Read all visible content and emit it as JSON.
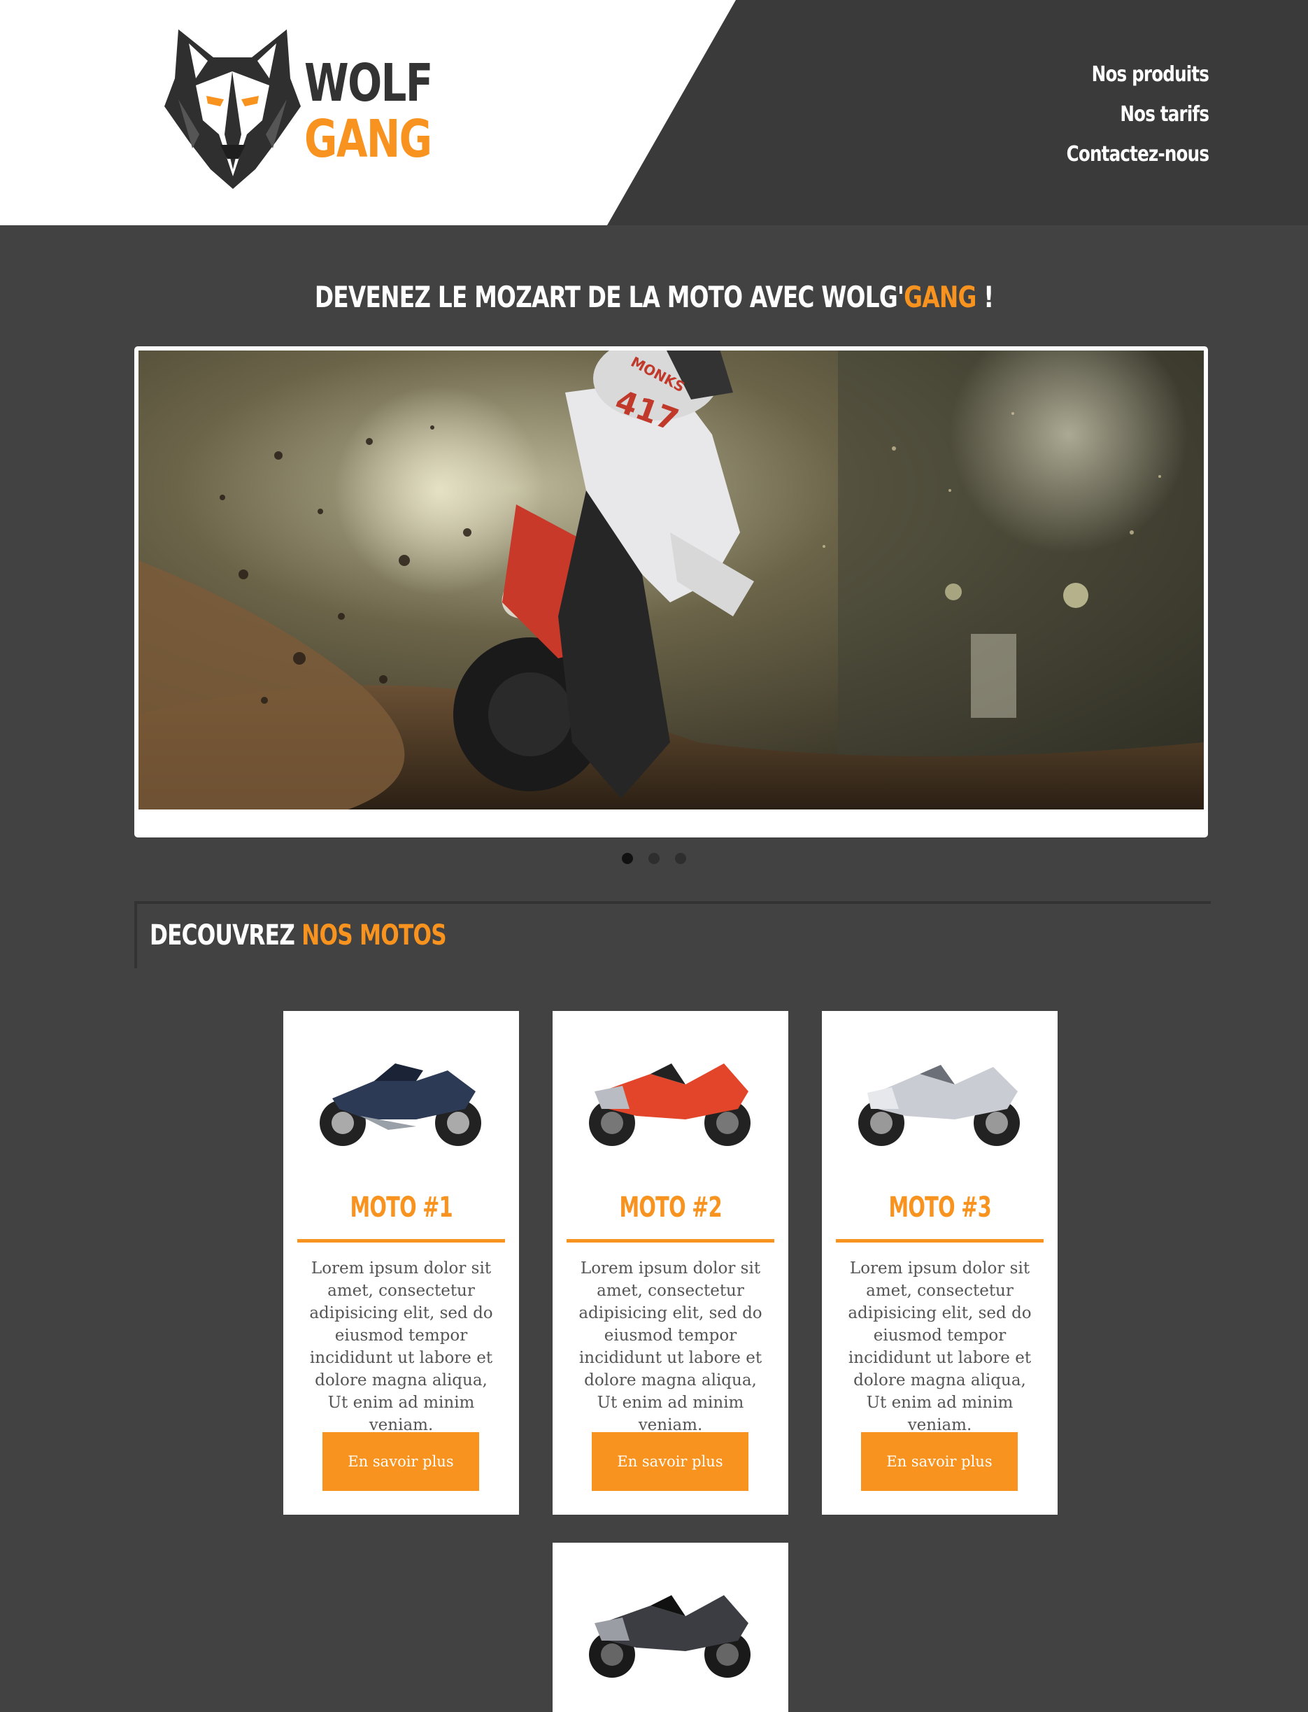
{
  "brand": {
    "line1": "WOLF",
    "line2": "GANG"
  },
  "nav": {
    "items": [
      "Nos produits",
      "Nos tarifs",
      "Contactez-nous"
    ]
  },
  "hero": {
    "headline_prefix": "DEVENEZ LE MOZART DE LA MOTO AVEC WOLG'",
    "headline_accent": "GANG",
    "headline_suffix": " !",
    "bike_number": "417",
    "rider_name": "MONKS",
    "slides_count": 3,
    "active_slide": 1
  },
  "section": {
    "title_prefix": "DECOUVREZ ",
    "title_accent": "NOS MOTOS"
  },
  "cards": [
    {
      "title": "MOTO #1",
      "text": "Lorem ipsum dolor sit amet, consectetur adipisicing elit, sed do eiusmod tempor incididunt ut labore et dolore magna aliqua, Ut enim ad minim veniam.",
      "button": "En savoir plus",
      "bike_color": "#2d3a55"
    },
    {
      "title": "MOTO #2",
      "text": "Lorem ipsum dolor sit amet, consectetur adipisicing elit, sed do eiusmod tempor incididunt ut labore et dolore magna aliqua, Ut enim ad minim veniam.",
      "button": "En savoir plus",
      "bike_color": "#e2452a"
    },
    {
      "title": "MOTO #3",
      "text": "Lorem ipsum dolor sit amet, consectetur adipisicing elit, sed do eiusmod tempor incididunt ut labore et dolore magna aliqua, Ut enim ad minim veniam.",
      "button": "En savoir plus",
      "bike_color": "#c9ccd2"
    },
    {
      "bike_color": "#3b3d42"
    }
  ],
  "colors": {
    "accent": "#f7931e",
    "background": "#424242",
    "header_dark": "#3a3a3a"
  }
}
